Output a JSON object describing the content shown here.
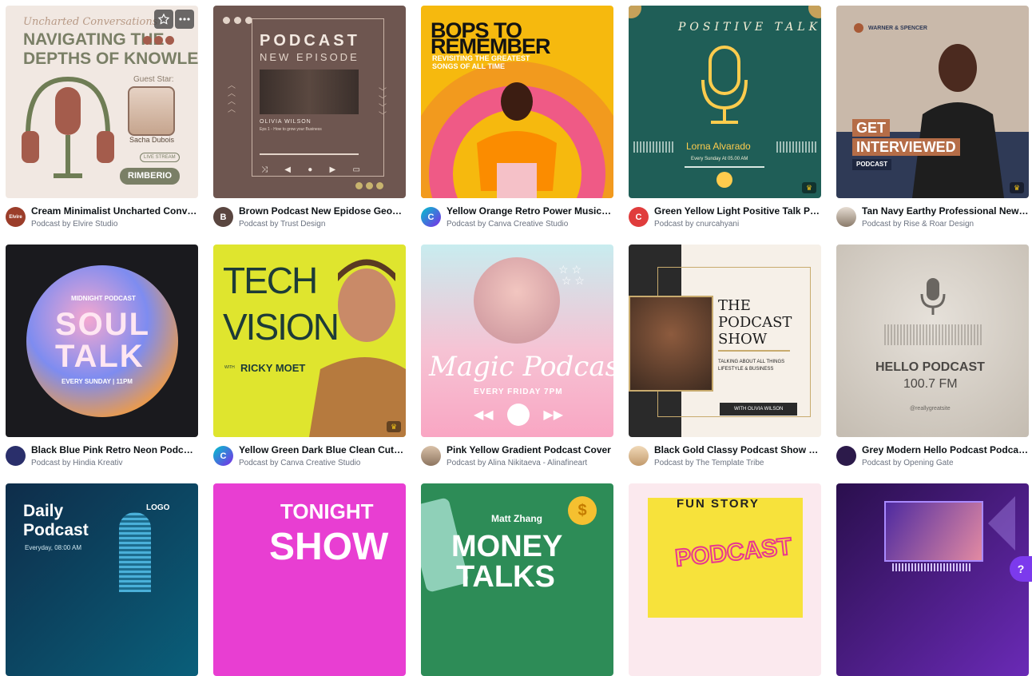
{
  "cards": [
    {
      "title": "Cream Minimalist Uncharted Conver...",
      "byline": "Podcast by Elvire Studio",
      "avatar_text": "Elvire",
      "thumb": {
        "top_script": "Uncharted Conversations",
        "headline_1": "NAVIGATING THE",
        "headline_2": "DEPTHS OF KNOWLEDGE",
        "guest_label": "Guest Star:",
        "guest_name": "Sacha Dubois",
        "live_label": "LIVE STREAM",
        "brand": "RIMBERIO"
      },
      "favorite_icon": "star-outline-icon",
      "more_icon": "more-dots-icon"
    },
    {
      "title": "Brown Podcast New Epidose Geomet...",
      "byline": "Podcast by Trust Design",
      "avatar_text": "B",
      "thumb": {
        "headline_1": "PODCAST",
        "headline_2": "NEW EPISODE",
        "host": "OLIVIA WILSON",
        "episode": "Eps 1 - How to grow your Business"
      }
    },
    {
      "title": "Yellow Orange Retro Power Music Po...",
      "byline": "Podcast by Canva Creative Studio",
      "avatar_text": "C",
      "thumb": {
        "headline_1": "BOPS TO",
        "headline_2": "REMEMBER",
        "sub_1": "REVISITING THE GREATEST",
        "sub_2": "SONGS OF ALL TIME"
      }
    },
    {
      "title": "Green Yellow Light Positive Talk Podc...",
      "byline": "Podcast by cnurcahyani",
      "avatar_text": "C",
      "thumb": {
        "arc_text": "POSITIVE TALK",
        "host": "Lorna Alvarado",
        "schedule": "Every Sunday At 05.00 AM"
      },
      "premium": true
    },
    {
      "title": "Tan Navy Earthy Professional News I...",
      "byline": "Podcast by Rise & Roar Design",
      "avatar_text": "",
      "thumb": {
        "brand": "WARNER & SPENCER",
        "headline_1": "GET",
        "headline_2": "INTERVIEWED",
        "tag": "PODCAST"
      },
      "premium": true
    },
    {
      "title": "Black Blue Pink Retro Neon Podcast ...",
      "byline": "Podcast by Hindia Kreativ",
      "avatar_text": "",
      "thumb": {
        "sub": "MIDNIGHT PODCAST",
        "headline_1": "SOUL",
        "headline_2": "TALK",
        "schedule": "EVERY SUNDAY | 11PM"
      }
    },
    {
      "title": "Yellow Green Dark Blue Clean Cutout...",
      "byline": "Podcast by Canva Creative Studio",
      "avatar_text": "C",
      "thumb": {
        "headline_1": "TECH",
        "headline_2": "VISION",
        "with_label": "WITH",
        "host": "RICKY MOET"
      },
      "premium": true
    },
    {
      "title": "Pink Yellow Gradient Podcast Cover",
      "byline": "Podcast by Alina Nikitaeva - Alinafineart",
      "avatar_text": "",
      "thumb": {
        "headline": "Magic Podcast",
        "schedule": "EVERY FRIDAY 7PM"
      }
    },
    {
      "title": "Black Gold Classy Podcast Show Cover",
      "byline": "Podcast by The Template Tribe",
      "avatar_text": "",
      "thumb": {
        "headline_1": "THE",
        "headline_2": "PODCAST",
        "headline_3": "SHOW",
        "sub_1": "TALKING ABOUT ALL THINGS",
        "sub_2": "LIFESTYLE & BUSINESS",
        "host": "WITH OLIVIA WILSON"
      }
    },
    {
      "title": "Grey Modern Hello Podcast Podcast ...",
      "byline": "Podcast by Opening Gate",
      "avatar_text": "",
      "thumb": {
        "headline": "HELLO PODCAST",
        "frequency": "100.7 FM",
        "handle": "@reallygreatsite"
      }
    },
    {
      "thumb": {
        "headline_1": "Daily",
        "headline_2": "Podcast",
        "logo": "LOGO",
        "schedule": "Everyday, 08:00 AM"
      }
    },
    {
      "thumb": {
        "headline_1": "TONIGHT",
        "headline_2": "SHOW"
      }
    },
    {
      "thumb": {
        "host": "Matt Zhang",
        "headline_1": "MONEY",
        "headline_2": "TALKS",
        "coin": "$"
      }
    },
    {
      "thumb": {
        "headline_1": "FUN STORY",
        "headline_2": "PODCAST"
      }
    },
    {
      "thumb": {}
    }
  ],
  "help_button": "?",
  "premium_icon": "crown-icon",
  "colors": {
    "brand_purple": "#7c3aed",
    "title_text": "#0d1216",
    "byline_text": "#6b7280"
  }
}
